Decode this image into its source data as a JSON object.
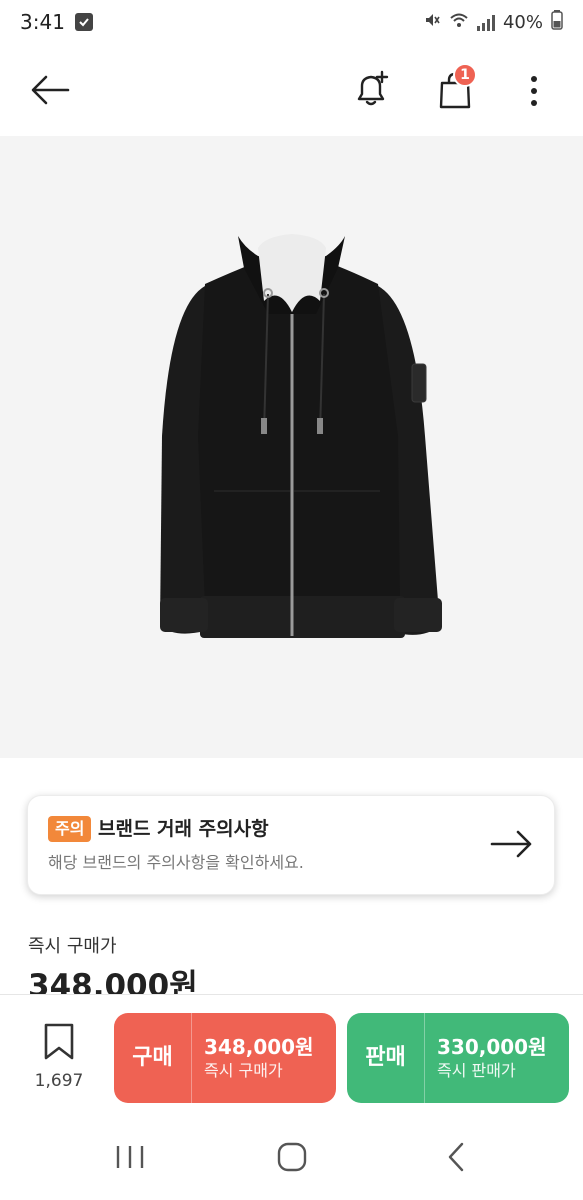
{
  "status_bar": {
    "time": "3:41",
    "battery": "40%"
  },
  "header": {
    "cart_badge_count": "1"
  },
  "notice": {
    "tag": "주의",
    "title": "브랜드 거래 주의사항",
    "description": "해당 브랜드의 주의사항을 확인하세요."
  },
  "price": {
    "label": "즉시 구매가",
    "value": "348,000원"
  },
  "bookmark": {
    "count": "1,697"
  },
  "buy": {
    "label": "구매",
    "price": "348,000원",
    "sub_label": "즉시 구매가",
    "color": "#ef6253"
  },
  "sell": {
    "label": "판매",
    "price": "330,000원",
    "sub_label": "즉시 판매가",
    "color": "#41b979"
  },
  "accent_colors": {
    "notice_tag": "#f2883a",
    "badge": "#ef6253"
  }
}
